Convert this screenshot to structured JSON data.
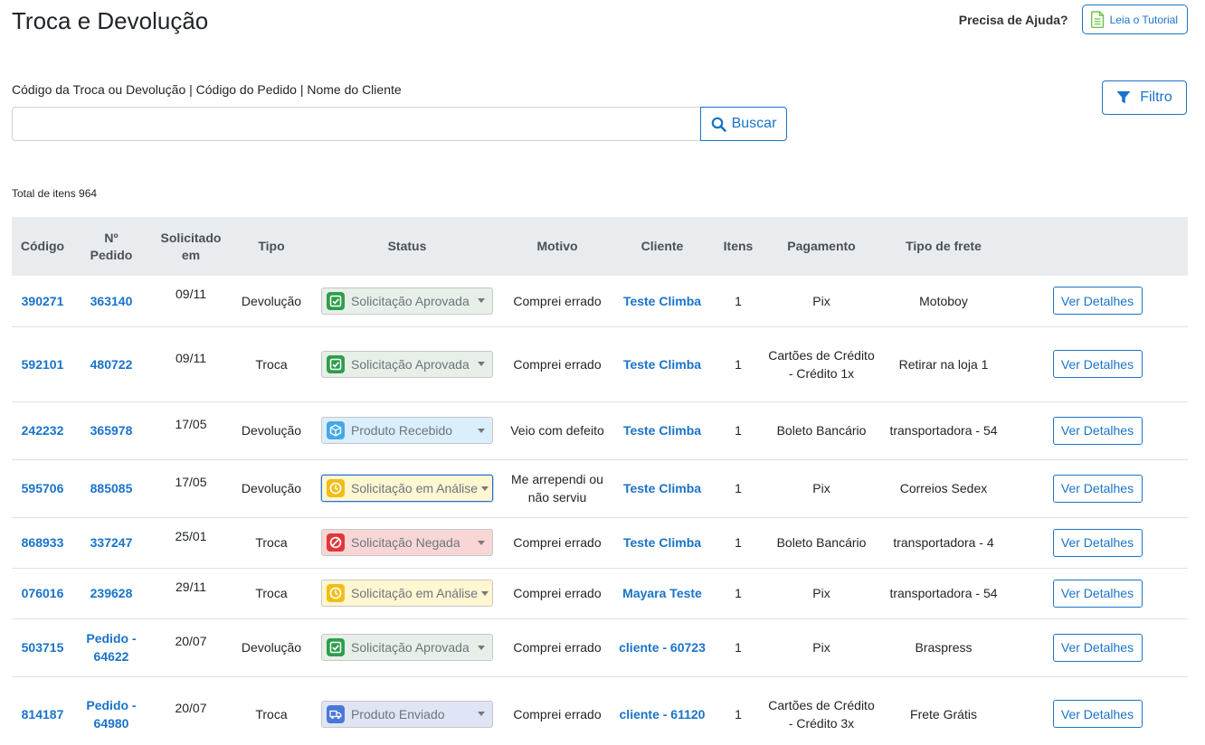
{
  "page": {
    "title": "Troca e Devolução",
    "help_text": "Precisa de Ajuda?",
    "tutorial_label": "Leia o Tutorial"
  },
  "search": {
    "label": "Código da Troca ou Devolução | Código do Pedido | Nome do Cliente",
    "value": "",
    "button_label": "Buscar"
  },
  "filter": {
    "label": "Filtro"
  },
  "total": "Total de itens 964",
  "table": {
    "headers": {
      "codigo": "Código",
      "pedido_1": "Nº",
      "pedido_2": "Pedido",
      "solicitado_1": "Solicitado",
      "solicitado_2": "em",
      "tipo": "Tipo",
      "status": "Status",
      "motivo": "Motivo",
      "cliente": "Cliente",
      "itens": "Itens",
      "pagamento": "Pagamento",
      "frete": "Tipo de frete"
    },
    "details_label": "Ver Detalhes",
    "rows": [
      {
        "codigo": "390271",
        "pedido": "363140",
        "data": "09/11",
        "tipo": "Devolução",
        "status": "Solicitação Aprovada",
        "status_kind": "green",
        "motivo": "Comprei errado",
        "cliente": "Teste Climba",
        "itens": "1",
        "pagamento": "Pix",
        "frete": "Motoboy"
      },
      {
        "codigo": "592101",
        "pedido": "480722",
        "data": "09/11",
        "tipo": "Troca",
        "status": "Solicitação Aprovada",
        "status_kind": "green",
        "motivo": "Comprei errado",
        "cliente": "Teste Climba",
        "itens": "1",
        "pagamento": "Cartões de Crédito - Crédito 1x",
        "frete": "Retirar na loja 1"
      },
      {
        "codigo": "242232",
        "pedido": "365978",
        "data": "17/05",
        "tipo": "Devolução",
        "status": "Produto Recebido",
        "status_kind": "blue",
        "motivo": "Veio com defeito",
        "cliente": "Teste Climba",
        "itens": "1",
        "pagamento": "Boleto Bancário",
        "frete": "transportadora - 54"
      },
      {
        "codigo": "595706",
        "pedido": "885085",
        "data": "17/05",
        "tipo": "Devolução",
        "status": "Solicitação em Análise",
        "status_kind": "yellow",
        "motivo": "Me arrependi ou não serviu",
        "cliente": "Teste Climba",
        "itens": "1",
        "pagamento": "Pix",
        "frete": "Correios Sedex"
      },
      {
        "codigo": "868933",
        "pedido": "337247",
        "data": "25/01",
        "tipo": "Troca",
        "status": "Solicitação Negada",
        "status_kind": "red",
        "motivo": "Comprei errado",
        "cliente": "Teste Climba",
        "itens": "1",
        "pagamento": "Boleto Bancário",
        "frete": "transportadora - 4"
      },
      {
        "codigo": "076016",
        "pedido": "239628",
        "data": "29/11",
        "tipo": "Troca",
        "status": "Solicitação em Análise",
        "status_kind": "yellow",
        "motivo": "Comprei errado",
        "cliente": "Mayara Teste",
        "itens": "1",
        "pagamento": "Pix",
        "frete": "transportadora - 54"
      },
      {
        "codigo": "503715",
        "pedido": "Pedido - 64622",
        "data": "20/07",
        "tipo": "Devolução",
        "status": "Solicitação Aprovada",
        "status_kind": "green",
        "motivo": "Comprei errado",
        "cliente": "cliente - 60723",
        "itens": "1",
        "pagamento": "Pix",
        "frete": "Braspress"
      },
      {
        "codigo": "814187",
        "pedido": "Pedido - 64980",
        "data": "20/07",
        "tipo": "Troca",
        "status": "Produto Enviado",
        "status_kind": "indigo",
        "motivo": "Comprei errado",
        "cliente": "cliente - 61120",
        "itens": "1",
        "pagamento": "Cartões de Crédito - Crédito 3x",
        "frete": "Frete Grátis"
      }
    ]
  }
}
